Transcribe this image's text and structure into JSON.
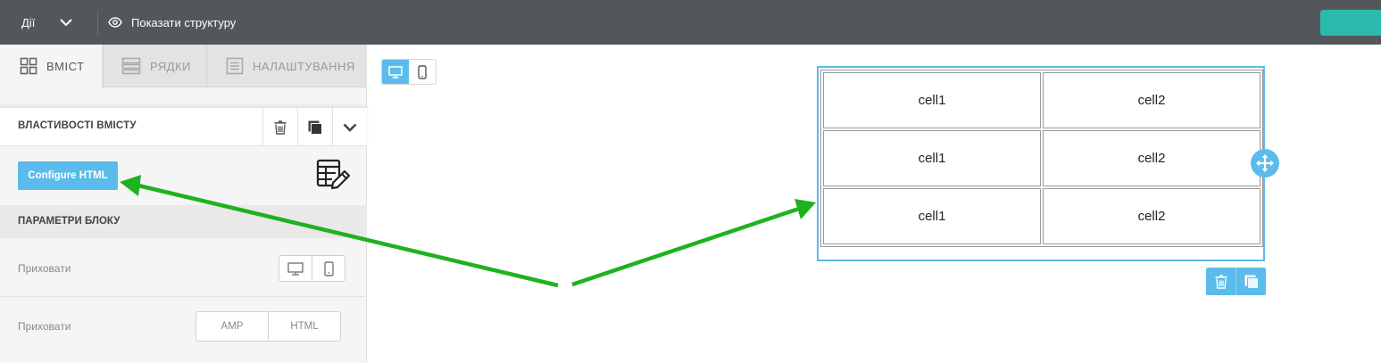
{
  "topbar": {
    "actions_label": "Дії",
    "show_structure_label": "Показати структуру",
    "accent_color": "#2bbbad"
  },
  "sidebar": {
    "tabs": [
      {
        "label": "ВМІСТ",
        "icon": "grid-icon",
        "active": true
      },
      {
        "label": "РЯДКИ",
        "icon": "rows-icon",
        "active": false
      },
      {
        "label": "НАЛАШТУВАННЯ",
        "icon": "settings-doc-icon",
        "active": false
      }
    ],
    "content_properties_title": "ВЛАСТИВОСТІ ВМІСТУ",
    "configure_html_label": "Configure HTML",
    "block_params_title": "ПАРАМЕТРИ БЛОКУ",
    "hide_device_label": "Приховати",
    "hide_format_label": "Приховати",
    "format_options": [
      "AMP",
      "HTML"
    ]
  },
  "canvas": {
    "table": [
      [
        "cell1",
        "cell2"
      ],
      [
        "cell1",
        "cell2"
      ],
      [
        "cell1",
        "cell2"
      ]
    ],
    "selection_color": "#5bbbea",
    "arrow_color": "#1fb21f"
  }
}
